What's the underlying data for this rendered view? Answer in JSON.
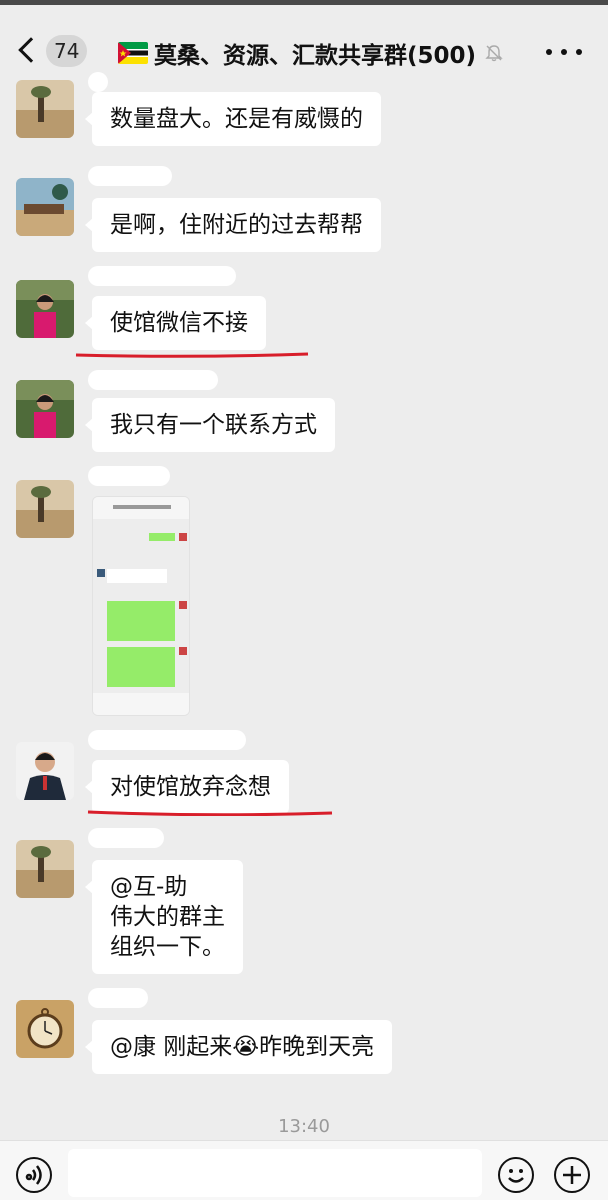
{
  "header": {
    "back_count": "74",
    "title": "莫桑、资源、汇款共享群(500)",
    "flag_icon": "mozambique-flag-icon",
    "mute_icon": "bell-slash-icon",
    "more_icon": "more-dots-icon"
  },
  "messages": [
    {
      "text": "数量盘大。还是有威慑的",
      "avatar": "landscape-horse-avatar"
    },
    {
      "text": "是啊，住附近的过去帮帮",
      "avatar": "beach-avatar"
    },
    {
      "text": "使馆微信不接",
      "avatar": "woman-pink-avatar"
    },
    {
      "text": "我只有一个联系方式",
      "avatar": "woman-pink-avatar"
    },
    {
      "text": "",
      "avatar": "landscape-horse-avatar",
      "image": "chat-screenshot-image"
    },
    {
      "text": "对使馆放弃念想",
      "avatar": "man-suit-avatar"
    },
    {
      "text": "@互-助\n伟大的群主\n组织一下。",
      "avatar": "landscape-horse-avatar"
    },
    {
      "text": "@康 刚起来😭昨晚到天亮",
      "avatar": "pocket-watch-avatar"
    }
  ],
  "timestamp": "13:40",
  "input": {
    "voice_icon": "voice-icon",
    "emoji_icon": "emoji-icon",
    "plus_icon": "plus-icon",
    "placeholder": ""
  },
  "colors": {
    "background": "#ededed",
    "bubble": "#ffffff",
    "underline": "#d81e2a",
    "mozambique_green": "#009a44"
  }
}
